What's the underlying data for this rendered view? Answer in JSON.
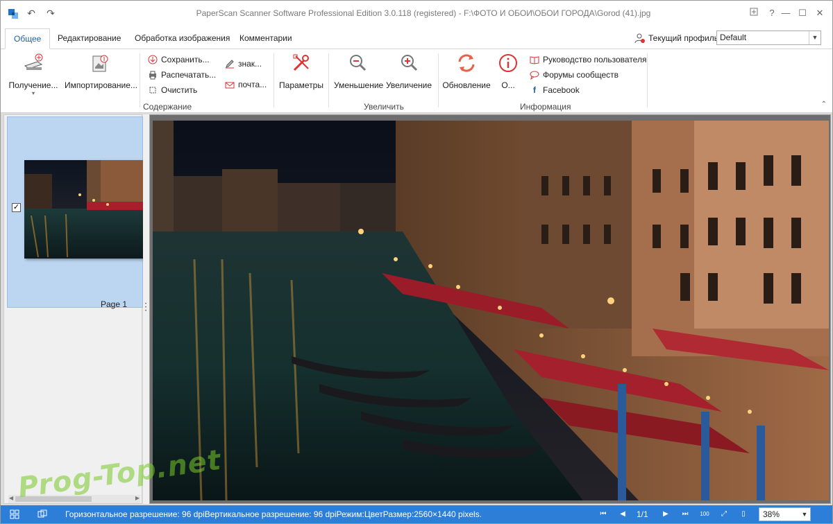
{
  "window": {
    "title": "PaperScan Scanner Software Professional Edition 3.0.118 (registered) - F:\\ФОТО И ОБОИ\\ОБОИ ГОРОДА\\Gorod  (41).jpg"
  },
  "tabs": [
    {
      "label": "Общее",
      "active": true
    },
    {
      "label": "Редактирование",
      "active": false
    },
    {
      "label": "Обработка изображения",
      "active": false
    },
    {
      "label": "Комментарии",
      "active": false
    }
  ],
  "profile": {
    "label": "Текущий профиль:",
    "value": "Default"
  },
  "ribbon": {
    "acquire": "Получение...",
    "import": "Импортирование...",
    "save": "Сохранить...",
    "print": "Распечатать...",
    "clear": "Очистить",
    "sign": "знак...",
    "mail": "почта...",
    "settings": "Параметры",
    "zoom_out": "Уменьшение",
    "zoom_in": "Увеличение",
    "update": "Обновление",
    "about": "О...",
    "manual": "Руководство пользователя",
    "forums": "Форумы сообществ",
    "facebook": "Facebook",
    "group_content": "Содержание",
    "group_zoom": "Увеличить",
    "group_info": "Информация"
  },
  "thumbnails": [
    {
      "label": "Page 1",
      "checked": true
    }
  ],
  "statusbar": {
    "info": "Горизонтальное разрешение: 96 dpiВертикальное разрешение: 96 dpiРежим:ЦветРазмер:2560×1440 pixels.",
    "page": "1/1",
    "zoom": "38%"
  },
  "watermark": "Prog-Top.net",
  "colors": {
    "accent": "#1e5fa8",
    "statusbar": "#2d7ed6",
    "selection": "#bcd6f2"
  }
}
